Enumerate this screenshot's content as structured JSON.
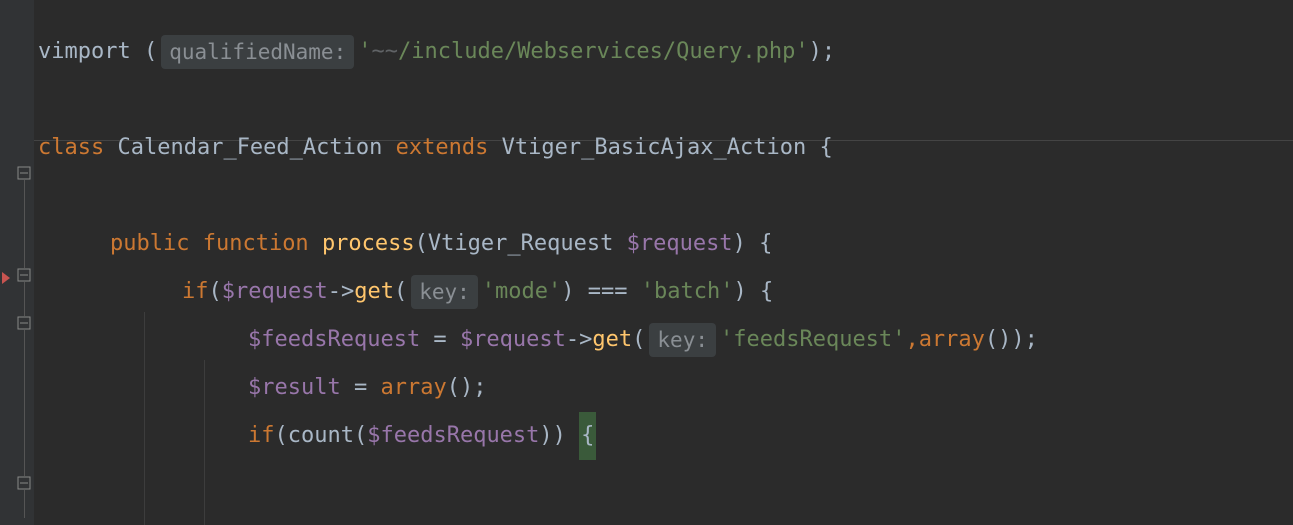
{
  "line1": {
    "fn": "vimport",
    "open": " (",
    "hint": "qualifiedName:",
    "q1": "'",
    "tilde": "~~",
    "path": "/include/Webservices/Query.php",
    "q2": "'",
    "close": ");"
  },
  "line3": {
    "kw1": "class ",
    "name": "Calendar_Feed_Action ",
    "kw2": "extends ",
    "parent": "Vtiger_BasicAjax_Action ",
    "brace": "{"
  },
  "line5": {
    "kw1": "public ",
    "kw2": "function ",
    "name": "process",
    "open": "(",
    "type": "Vtiger_Request ",
    "var": "$request",
    "close": ") ",
    "brace": "{"
  },
  "line6": {
    "kw": "if",
    "open": "(",
    "var": "$request",
    "arrow": "->",
    "method": "get",
    "open2": "(",
    "hint": "key:",
    "q1": "'",
    "s1": "mode",
    "q2": "'",
    "close2": ") ",
    "op": "=== ",
    "q3": "'",
    "s2": "batch",
    "q4": "'",
    "close": ") ",
    "brace": "{"
  },
  "line7": {
    "var": "$feedsRequest",
    "eq": " = ",
    "var2": "$request",
    "arrow": "->",
    "method": "get",
    "open": "(",
    "hint": "key:",
    "q1": "'",
    "s1": "feedsRequest",
    "q2": "'",
    "comma": ",",
    "kw": "array",
    "paren": "()",
    "close": ");"
  },
  "line8": {
    "var": "$result",
    "eq": " = ",
    "kw": "array",
    "paren": "();"
  },
  "line9": {
    "kw": "if",
    "open": "(",
    "fn": "count",
    "open2": "(",
    "var": "$feedsRequest",
    "close2": ")",
    "close": ") ",
    "brace": "{"
  }
}
